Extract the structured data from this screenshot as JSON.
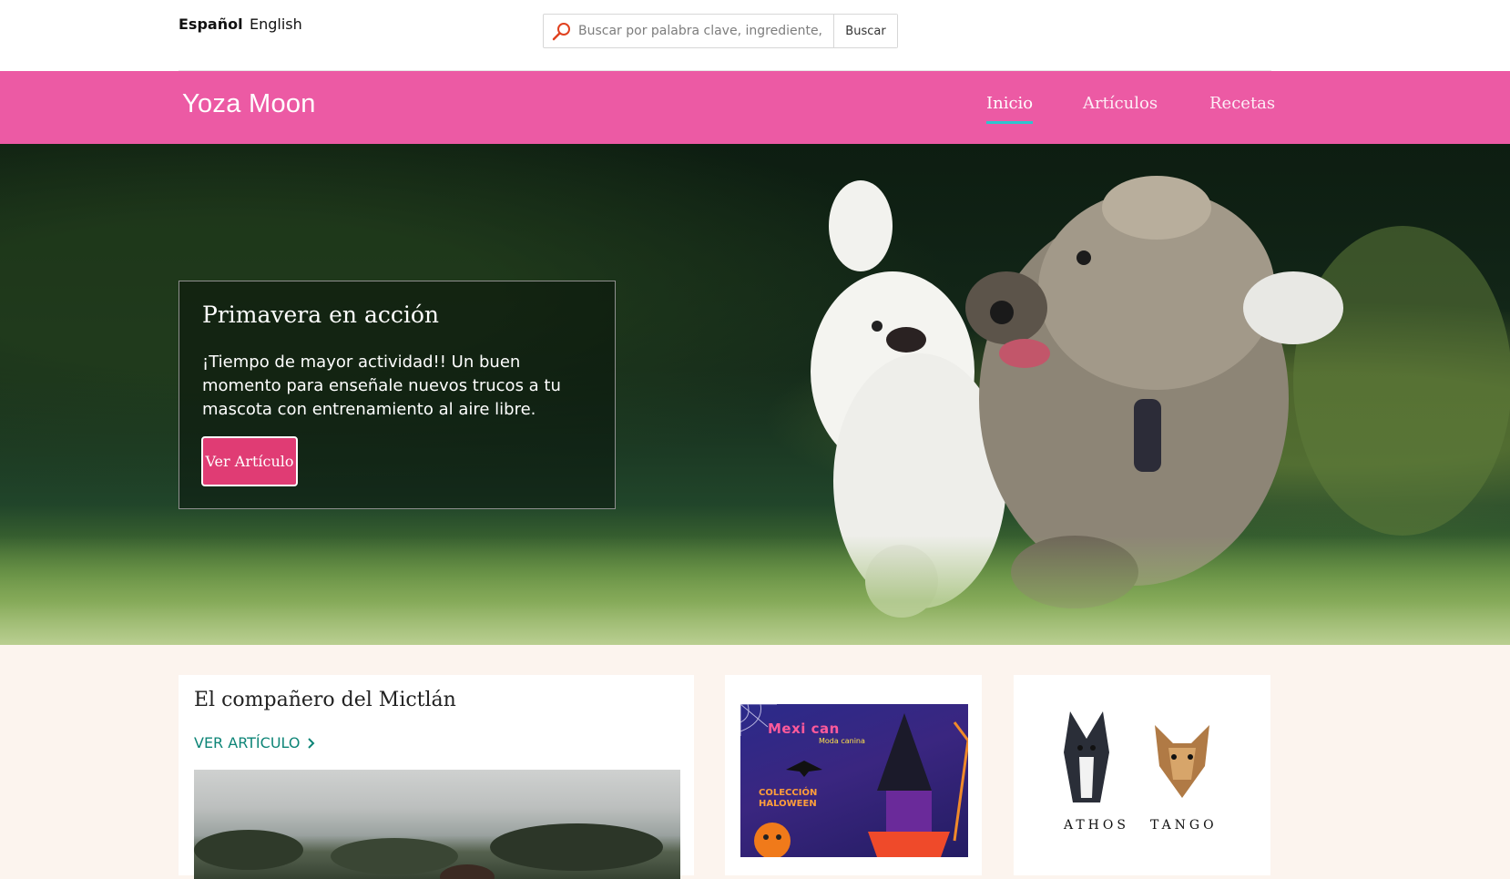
{
  "header": {
    "languages": [
      {
        "label": "Español",
        "active": true
      },
      {
        "label": "English",
        "active": false
      }
    ],
    "search": {
      "placeholder": "Buscar por palabra clave, ingrediente, pl",
      "button_label": "Buscar",
      "icon": "search-icon"
    }
  },
  "nav": {
    "logo_text": "Yoza Moon",
    "brand_color": "#ec5aa4",
    "items": [
      {
        "label": "Inicio",
        "active": true
      },
      {
        "label": "Artículos",
        "active": false
      },
      {
        "label": "Recetas",
        "active": false
      }
    ],
    "active_indicator_color": "#2ec4cf"
  },
  "hero": {
    "title": "Primavera en acción",
    "text": "¡Tiempo de mayor actividad!!  Un buen momento para enseñale nuevos trucos a tu mascota con entrenamiento al aire libre.",
    "button_label": "Ver Artículo",
    "button_color": "#e03c74"
  },
  "cards": {
    "article": {
      "title": "El compañero del Mictlán",
      "link_label": "VER ARTÍCULO",
      "link_color": "#0e8577"
    },
    "promo": {
      "brand": "Mexi can",
      "subtitle": "Moda canina",
      "collection": "COLECCIÓN HALOWEEN"
    },
    "memorial": {
      "names": [
        "ATHOS",
        "TANGO"
      ]
    }
  }
}
